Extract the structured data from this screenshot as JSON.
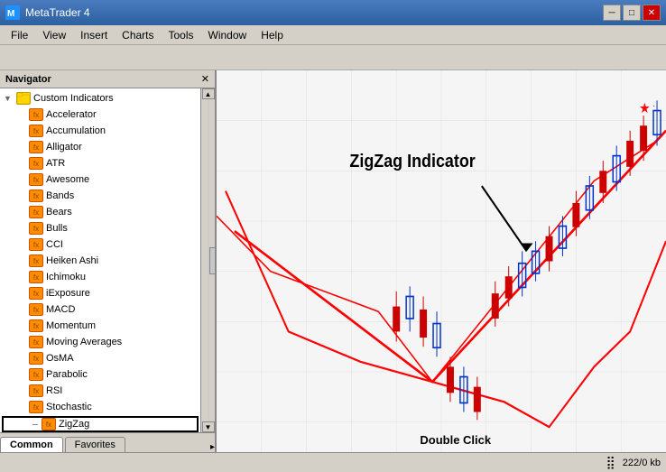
{
  "titleBar": {
    "title": "MetaTrader 4",
    "icon": "MT4",
    "minimizeLabel": "─",
    "maximizeLabel": "□",
    "closeLabel": "✕"
  },
  "menuBar": {
    "items": [
      "File",
      "View",
      "Insert",
      "Charts",
      "Tools",
      "Window",
      "Help"
    ]
  },
  "navigator": {
    "title": "Navigator",
    "closeLabel": "✕",
    "treeItems": [
      {
        "level": 0,
        "label": "Custom Indicators",
        "expanded": true,
        "hasIcon": true,
        "isFolder": true
      },
      {
        "level": 1,
        "label": "Accelerator",
        "hasIcon": true
      },
      {
        "level": 1,
        "label": "Accumulation",
        "hasIcon": true
      },
      {
        "level": 1,
        "label": "Alligator",
        "hasIcon": true
      },
      {
        "level": 1,
        "label": "ATR",
        "hasIcon": true
      },
      {
        "level": 1,
        "label": "Awesome",
        "hasIcon": true
      },
      {
        "level": 1,
        "label": "Bands",
        "hasIcon": true
      },
      {
        "level": 1,
        "label": "Bears",
        "hasIcon": true
      },
      {
        "level": 1,
        "label": "Bulls",
        "hasIcon": true
      },
      {
        "level": 1,
        "label": "CCI",
        "hasIcon": true
      },
      {
        "level": 1,
        "label": "Heiken Ashi",
        "hasIcon": true
      },
      {
        "level": 1,
        "label": "Ichimoku",
        "hasIcon": true
      },
      {
        "level": 1,
        "label": "iExposure",
        "hasIcon": true
      },
      {
        "level": 1,
        "label": "MACD",
        "hasIcon": true
      },
      {
        "level": 1,
        "label": "Momentum",
        "hasIcon": true
      },
      {
        "level": 1,
        "label": "Moving Averages",
        "hasIcon": true
      },
      {
        "level": 1,
        "label": "OsMA",
        "hasIcon": true
      },
      {
        "level": 1,
        "label": "Parabolic",
        "hasIcon": true
      },
      {
        "level": 1,
        "label": "RSI",
        "hasIcon": true
      },
      {
        "level": 1,
        "label": "Stochastic",
        "hasIcon": true
      },
      {
        "level": 1,
        "label": "ZigZag",
        "hasIcon": true,
        "highlighted": true
      }
    ],
    "tabs": [
      {
        "label": "Common",
        "active": true
      },
      {
        "label": "Favorites",
        "active": false
      }
    ]
  },
  "chart": {
    "annotation": "ZigZag Indicator",
    "doubleClickLabel": "Double Click"
  },
  "statusBar": {
    "memory": "222/0 kb"
  }
}
